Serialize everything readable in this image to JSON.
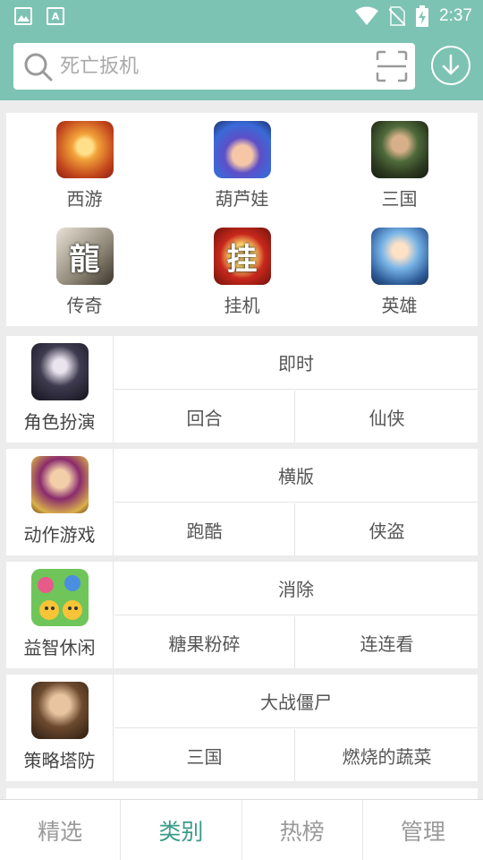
{
  "status_bar": {
    "time": "2:37",
    "left_icons": [
      "image-notification-icon",
      "text-notification-icon"
    ],
    "right_icons": [
      "wifi-icon",
      "no-sim-icon",
      "battery-charging-icon"
    ],
    "notification_glyph": "A"
  },
  "header": {
    "search_placeholder": "死亡扳机",
    "search_icon": "search-icon",
    "scan_icon": "scan-icon",
    "download_icon": "download-icon"
  },
  "colors": {
    "accent": "#7dc3b3",
    "active_tab": "#3a9c8a",
    "inactive_tab": "#9a9a9a",
    "background": "#ececec"
  },
  "featured": [
    {
      "label": "西游",
      "icon": "xiyou-game-icon"
    },
    {
      "label": "葫芦娃",
      "icon": "huluwa-game-icon"
    },
    {
      "label": "三国",
      "icon": "sanguo-game-icon"
    },
    {
      "label": "传奇",
      "icon": "chuanqi-game-icon",
      "glyph": "龍"
    },
    {
      "label": "挂机",
      "icon": "guaji-game-icon",
      "glyph": "挂"
    },
    {
      "label": "英雄",
      "icon": "yingxiong-game-icon"
    }
  ],
  "categories": [
    {
      "label": "角色扮演",
      "icon": "roleplay-game-icon",
      "tags": [
        "即时",
        "回合",
        "仙侠"
      ]
    },
    {
      "label": "动作游戏",
      "icon": "action-game-icon",
      "tags": [
        "横版",
        "跑酷",
        "侠盗"
      ]
    },
    {
      "label": "益智休闲",
      "icon": "puzzle-game-icon",
      "tags": [
        "消除",
        "糖果粉碎",
        "连连看"
      ]
    },
    {
      "label": "策略塔防",
      "icon": "strategy-game-icon",
      "tags": [
        "大战僵尸",
        "三国",
        "燃烧的蔬菜"
      ]
    }
  ],
  "bottom_nav": {
    "tabs": [
      "精选",
      "类别",
      "热榜",
      "管理"
    ],
    "active": "类别"
  }
}
